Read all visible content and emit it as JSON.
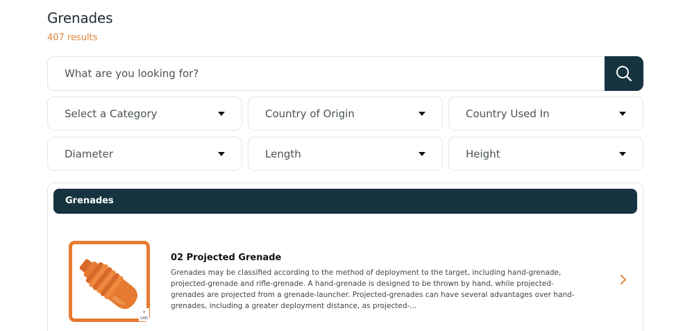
{
  "page": {
    "title": "Grenades",
    "result_count": "407 results"
  },
  "search": {
    "placeholder": "What are you looking for?",
    "button_icon": "search-icon"
  },
  "filters": [
    {
      "label": "Select a Category"
    },
    {
      "label": "Country of Origin"
    },
    {
      "label": "Country Used In"
    },
    {
      "label": "Diameter"
    },
    {
      "label": "Length"
    },
    {
      "label": "Height"
    }
  ],
  "results": {
    "section_title": "Grenades",
    "items": [
      {
        "title": "02 Projected Grenade",
        "description": "Grenades may be classified according to the method of deployment to the target, including hand-grenade, projected-grenade and rifle-grenade.   A hand-grenade is designed to be thrown by hand, while projected-grenades are projected from a grenade-launcher.   Projected-grenades can have several advantages over hand-grenades, including a greater deployment distance, as projected-...",
        "thumb_logo_text": "UXO"
      }
    ]
  },
  "colors": {
    "accent": "#e08537",
    "dark": "#16343f",
    "border": "#e1e4e6"
  }
}
